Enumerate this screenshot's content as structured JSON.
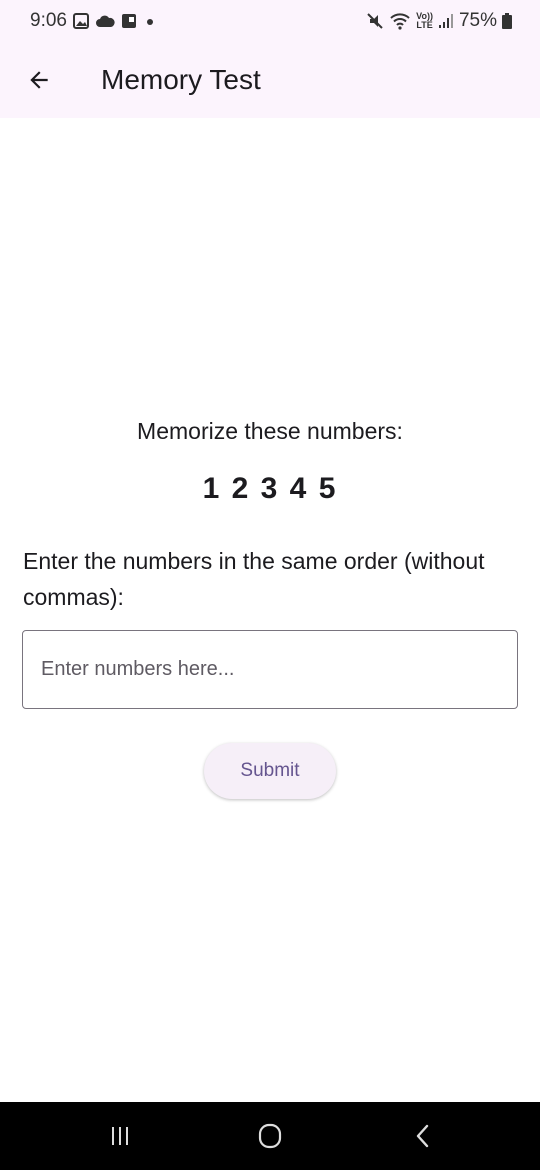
{
  "status_bar": {
    "time": "9:06",
    "battery": "75%",
    "icons_left": [
      "image-icon",
      "cloud-icon",
      "app-icon",
      "dot-icon"
    ],
    "icons_right": [
      "mute-icon",
      "wifi-icon",
      "volte-icon",
      "signal-icon",
      "battery-icon"
    ],
    "volte_top": "Vo))",
    "volte_bottom": "LTE"
  },
  "app_bar": {
    "title": "Memory Test",
    "back_icon": "arrow-back-icon"
  },
  "content": {
    "memorize_label": "Memorize these numbers:",
    "numbers": "1 2 3 4 5",
    "instructions": "Enter the numbers in the same order (without commas):",
    "input_placeholder": "Enter numbers here...",
    "input_value": "",
    "submit_label": "Submit"
  },
  "nav_bar": {
    "items": [
      "recents-icon",
      "home-icon",
      "back-icon"
    ]
  },
  "colors": {
    "app_bar_bg": "#fcf4fd",
    "button_text": "#65558f",
    "button_bg": "#f6eff8"
  }
}
